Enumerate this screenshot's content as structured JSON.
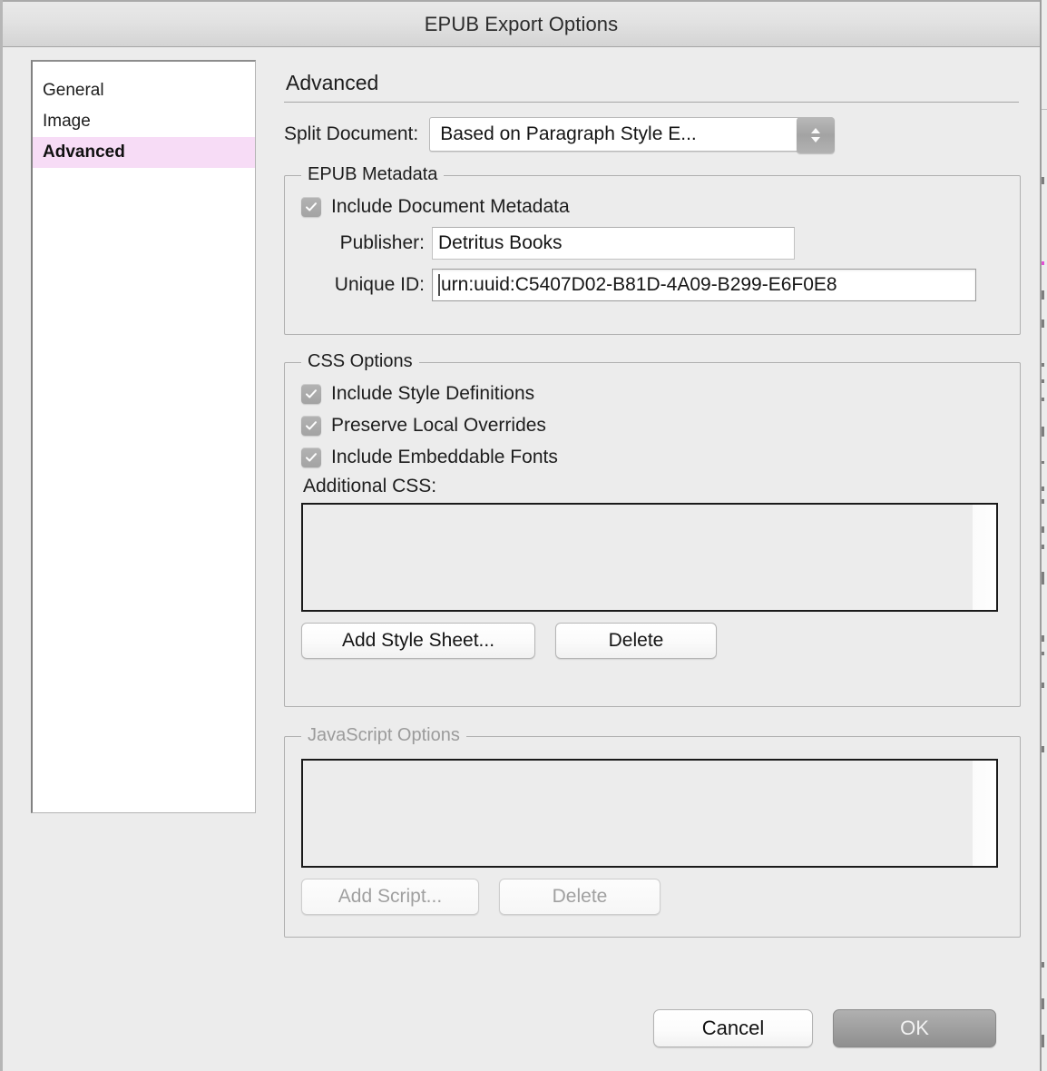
{
  "window": {
    "title": "EPUB Export Options"
  },
  "sidebar": {
    "items": [
      {
        "label": "General",
        "selected": false
      },
      {
        "label": "Image",
        "selected": false
      },
      {
        "label": "Advanced",
        "selected": true
      }
    ]
  },
  "main": {
    "pane_title": "Advanced",
    "split": {
      "label": "Split Document:",
      "value": "Based on Paragraph Style E...",
      "stepper_icon": "stepper-up-down-icon"
    },
    "metadata": {
      "legend": "EPUB Metadata",
      "include_metadata": {
        "label": "Include Document Metadata",
        "checked": true,
        "icon": "checkmark-icon"
      },
      "publisher": {
        "label": "Publisher:",
        "value": "Detritus Books",
        "placeholder": ""
      },
      "unique_id": {
        "label": "Unique ID:",
        "value": "urn:uuid:C5407D02-B81D-4A09-B299-E6F0E8",
        "placeholder": "",
        "focused": true
      }
    },
    "css_options": {
      "legend": "CSS Options",
      "checkboxes": [
        {
          "label": "Include Style Definitions",
          "checked": true,
          "icon": "checkmark-icon"
        },
        {
          "label": "Preserve Local Overrides",
          "checked": true,
          "icon": "checkmark-icon"
        },
        {
          "label": "Include Embeddable Fonts",
          "checked": true,
          "icon": "checkmark-icon"
        }
      ],
      "additional_css_label": "Additional CSS:",
      "list_items": [],
      "add_button": "Add Style Sheet...",
      "delete_button": "Delete"
    },
    "javascript_options": {
      "legend": "JavaScript Options",
      "disabled": true,
      "list_items": [],
      "add_button": "Add Script...",
      "delete_button": "Delete"
    }
  },
  "footer": {
    "cancel_label": "Cancel",
    "ok_label": "OK"
  },
  "colors": {
    "dialog_background": "#ececec",
    "selection_highlight": "#f7dcf6",
    "titlebar_top": "#e9e9e9",
    "titlebar_bottom": "#d4d4d4",
    "ok_button": "#9e9e9e",
    "text": "#1d1d1d",
    "disabled_text": "#9b9b9b"
  }
}
